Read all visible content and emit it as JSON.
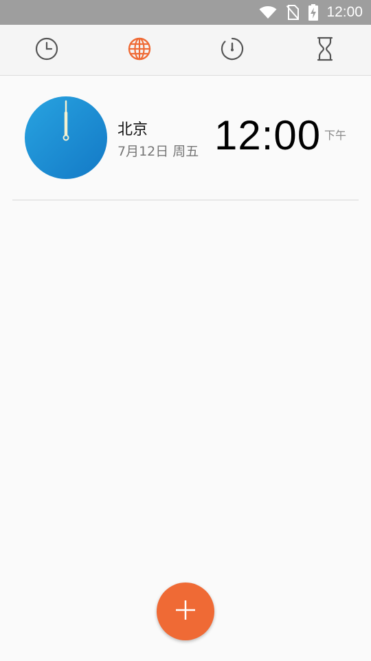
{
  "status_bar": {
    "time": "12:00",
    "icons": [
      "wifi-icon",
      "no-sim-icon",
      "battery-charging-icon"
    ]
  },
  "tabs": [
    {
      "icon": "alarm-clock-icon",
      "active": false
    },
    {
      "icon": "world-clock-globe-icon",
      "active": true
    },
    {
      "icon": "stopwatch-icon",
      "active": false
    },
    {
      "icon": "timer-hourglass-icon",
      "active": false
    }
  ],
  "world_clocks": [
    {
      "city": "北京",
      "date": "7月12日 周五",
      "time": "12:00",
      "ampm": "下午"
    }
  ],
  "fab": {
    "icon": "add-icon"
  },
  "colors": {
    "accent": "#ef6a35",
    "status_bar": "#9e9e9e",
    "clock_face": "#1e90d6",
    "inactive_icon": "#555555"
  }
}
